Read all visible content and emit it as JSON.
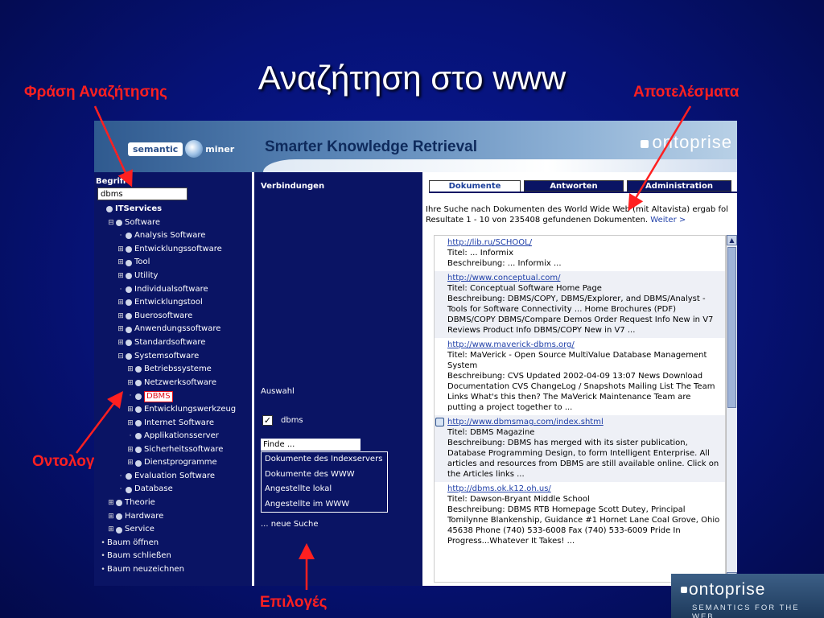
{
  "slide": {
    "title": "Αναζήτηση στο www",
    "annotations": {
      "search_phrase": "Φράση Αναζήτησης",
      "results": "Αποτελέσματα",
      "ontology": "Οντολογία",
      "options": "Επιλογές"
    },
    "annotation_color": "#ff2020"
  },
  "app": {
    "logo_left": "semantic",
    "logo_right": "miner",
    "tagline": "Smarter Knowledge Retrieval",
    "brand": "ontoprise"
  },
  "left": {
    "begriffe_label": "Begriffe",
    "search_value": "dbms",
    "tree": [
      {
        "label": "ITServices",
        "level": 0,
        "glyph": "",
        "bold": true
      },
      {
        "label": "Software",
        "level": 1,
        "glyph": "⊟"
      },
      {
        "label": "Analysis Software",
        "level": 2,
        "glyph": "·"
      },
      {
        "label": "Entwicklungssoftware",
        "level": 2,
        "glyph": "⊞"
      },
      {
        "label": "Tool",
        "level": 2,
        "glyph": "⊞"
      },
      {
        "label": "Utility",
        "level": 2,
        "glyph": "⊞"
      },
      {
        "label": "Individualsoftware",
        "level": 2,
        "glyph": "·"
      },
      {
        "label": "Entwicklungstool",
        "level": 2,
        "glyph": "⊞"
      },
      {
        "label": "Buerosoftware",
        "level": 2,
        "glyph": "⊞"
      },
      {
        "label": "Anwendungssoftware",
        "level": 2,
        "glyph": "⊞"
      },
      {
        "label": "Standardsoftware",
        "level": 2,
        "glyph": "⊞"
      },
      {
        "label": "Systemsoftware",
        "level": 2,
        "glyph": "⊟"
      },
      {
        "label": "Betriebssysteme",
        "level": 3,
        "glyph": "⊞"
      },
      {
        "label": "Netzwerksoftware",
        "level": 3,
        "glyph": "⊞"
      },
      {
        "label": "DBMS",
        "level": 3,
        "glyph": "·",
        "selected": true
      },
      {
        "label": "Entwicklungswerkzeug",
        "level": 3,
        "glyph": "⊞"
      },
      {
        "label": "Internet Software",
        "level": 3,
        "glyph": "⊞"
      },
      {
        "label": "Applikationsserver",
        "level": 3,
        "glyph": "·"
      },
      {
        "label": "Sicherheitssoftware",
        "level": 3,
        "glyph": "⊞"
      },
      {
        "label": "Dienstprogramme",
        "level": 3,
        "glyph": "⊞"
      },
      {
        "label": "Evaluation Software",
        "level": 2,
        "glyph": "·"
      },
      {
        "label": "Database",
        "level": 2,
        "glyph": "·"
      },
      {
        "label": "Theorie",
        "level": 1,
        "glyph": "⊞"
      },
      {
        "label": "Hardware",
        "level": 1,
        "glyph": "⊞"
      },
      {
        "label": "Service",
        "level": 1,
        "glyph": "⊞"
      },
      {
        "label": "Baum öffnen",
        "level": 0,
        "glyph": "•",
        "bullet": true
      },
      {
        "label": "Baum schließen",
        "level": 0,
        "glyph": "•",
        "bullet": true
      },
      {
        "label": "Baum neuzeichnen",
        "level": 0,
        "glyph": "•",
        "bullet": true
      }
    ]
  },
  "mid": {
    "header": "Verbindungen",
    "auswahl": "Auswahl",
    "checkbox_label": "dbms",
    "checkbox_checked": true,
    "find_selected": "Finde ...",
    "find_options": [
      "Dokumente des Indexservers",
      "Dokumente des WWW",
      "Angestellte lokal",
      "Angestellte im WWW"
    ],
    "new_search": "... neue Suche"
  },
  "right": {
    "tabs": [
      "Dokumente",
      "Antworten",
      "Administration"
    ],
    "intro_line1": "Ihre Suche nach Dokumenten des World Wide Web (mit Altavista) ergab fol",
    "intro_line2": "Resultate 1 - 10 von 235408 gefundenen Dokumenten.",
    "weiter": "Weiter >",
    "results": [
      {
        "url": "http://lib.ru/SCHOOL/",
        "title": "Titel: ... Informix",
        "desc": "Beschreibung: ... Informix ..."
      },
      {
        "url": "http://www.conceptual.com/",
        "title": "Titel: Conceptual Software Home Page",
        "desc": "Beschreibung: DBMS/COPY, DBMS/Explorer, and DBMS/Analyst - Tools for Software Connectivity ... Home Brochures (PDF) DBMS/COPY DBMS/Compare Demos Order Request Info New in V7 Reviews Product Info DBMS/COPY New in V7 ..."
      },
      {
        "url": "http://www.maverick-dbms.org/",
        "title": "Titel: MaVerick - Open Source MultiValue Database Management System",
        "desc": "Beschreibung: CVS Updated 2002-04-09 13:07 News Download Documentation CVS ChangeLog / Snapshots Mailing List The Team Links What's this then? The MaVerick Maintenance Team are putting a project together to ..."
      },
      {
        "url": "http://www.dbmsmag.com/index.shtml",
        "title": "Titel: DBMS Magazine",
        "desc": "Beschreibung: DBMS has merged with its sister publication, Database Programming Design, to form Intelligent Enterprise. All articles and resources from DBMS are still available online. Click on the Articles links ...",
        "icon": true
      },
      {
        "url": "http://dbms.ok.k12.oh.us/",
        "title": "Titel: Dawson-Bryant Middle School",
        "desc": "Beschreibung: DBMS RTB Homepage Scott Dutey, Principal Tomilynne Blankenship, Guidance #1 Hornet Lane Coal Grove, Ohio 45638 Phone (740) 533-6008 Fax (740) 533-6009 Pride In Progress...Whatever It Takes! ..."
      }
    ]
  },
  "corner": {
    "name": "ontoprise",
    "tag": "SEMANTICS FOR THE WEB"
  }
}
